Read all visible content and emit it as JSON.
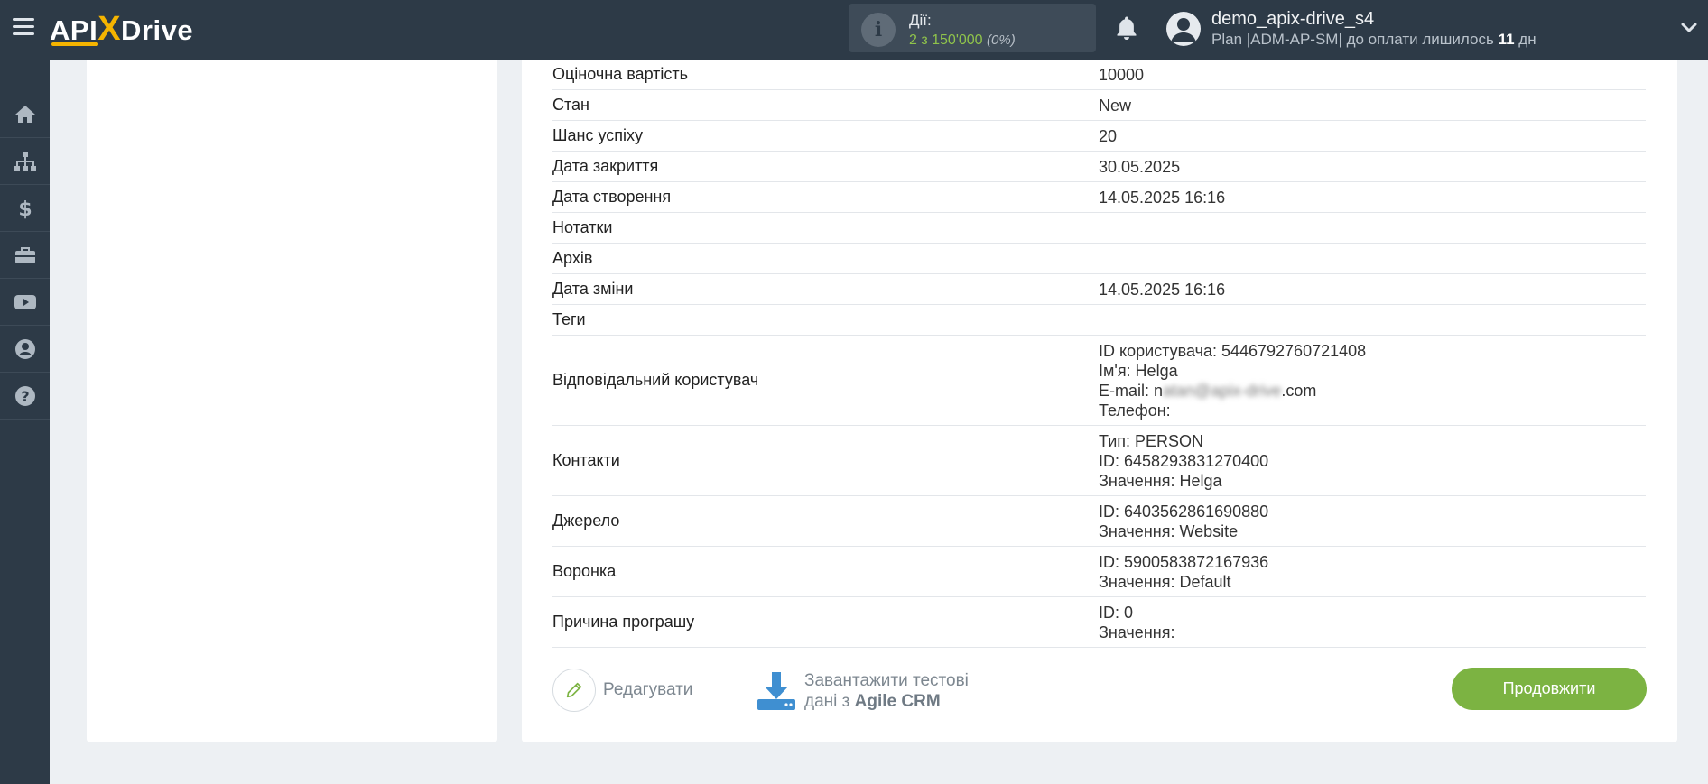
{
  "header": {
    "logo_api": "API",
    "logo_x": "X",
    "logo_drive": "Drive",
    "actions_title": "Дії:",
    "actions_count": "2 з 150'000",
    "actions_percent": "(0%)",
    "user_name": "demo_apix-drive_s4",
    "plan_prefix": "Plan |ADM-AP-SM| до оплати лишилось",
    "plan_days": "11",
    "plan_suffix": "дн"
  },
  "sidebar": {
    "items": [
      "home-icon",
      "sitemap-icon",
      "dollar-icon",
      "briefcase-icon",
      "youtube-icon",
      "user-circle-icon",
      "help-icon"
    ]
  },
  "table": {
    "rows": [
      {
        "key": "Оціночна вартість",
        "value": "10000"
      },
      {
        "key": "Стан",
        "value": "New"
      },
      {
        "key": "Шанс успіху",
        "value": "20"
      },
      {
        "key": "Дата закриття",
        "value": "30.05.2025"
      },
      {
        "key": "Дата створення",
        "value": "14.05.2025 16:16"
      },
      {
        "key": "Нотатки",
        "value": ""
      },
      {
        "key": "Архів",
        "value": ""
      },
      {
        "key": "Дата зміни",
        "value": "14.05.2025 16:16"
      },
      {
        "key": "Теги",
        "value": ""
      }
    ],
    "responsible": {
      "key": "Відповідальний користувач",
      "id_line": "ID користувача: 5446792760721408",
      "name_line": "Ім'я: Helga",
      "email_prefix": "E-mail: n",
      "email_blur": "atan@apix-drive",
      "email_suffix": ".com",
      "phone_line": "Телефон:"
    },
    "contacts": {
      "key": "Контакти",
      "lines": [
        "Тип: PERSON",
        "ID: 6458293831270400",
        "Значення: Helga"
      ]
    },
    "source": {
      "key": "Джерело",
      "lines": [
        "ID: 6403562861690880",
        "Значення: Website"
      ]
    },
    "funnel": {
      "key": "Воронка",
      "lines": [
        "ID: 5900583872167936",
        "Значення: Default"
      ]
    },
    "loss_reason": {
      "key": "Причина програшу",
      "lines": [
        "ID: 0",
        "Значення:"
      ]
    }
  },
  "buttons": {
    "edit": "Редагувати",
    "load_line1": "Завантажити тестові",
    "load_line2_prefix": "дані з",
    "load_line2_bold": "Agile CRM",
    "continue": "Продовжити"
  },
  "colors": {
    "header_bg": "#2d3a47",
    "accent_green": "#7cb342",
    "logo_yellow": "#f5b400",
    "download_blue": "#3f8fd1"
  }
}
